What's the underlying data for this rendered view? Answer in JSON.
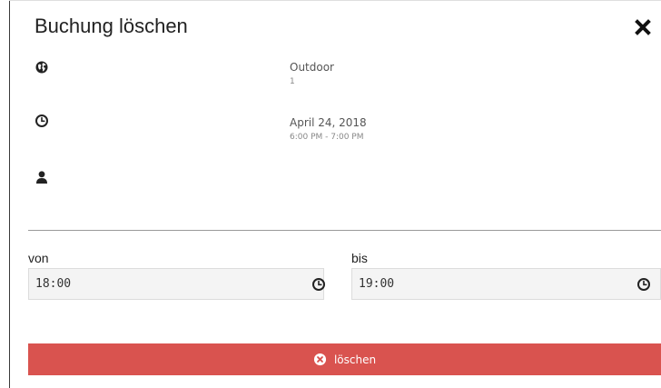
{
  "dialog": {
    "title": "Buchung löschen",
    "close_icon": "close-icon"
  },
  "details": {
    "location": {
      "icon": "globe-icon",
      "name": "Outdoor",
      "number": "1"
    },
    "time": {
      "icon": "clock-icon",
      "date": "April 24, 2018",
      "range": "6:00 PM - 7:00 PM"
    },
    "person": {
      "icon": "user-icon"
    }
  },
  "form": {
    "from": {
      "label": "von",
      "value": "18:00",
      "icon": "clock-icon"
    },
    "to": {
      "label": "bis",
      "value": "19:00",
      "icon": "clock-icon"
    }
  },
  "delete_button": {
    "label": "löschen",
    "icon": "times-circle-icon",
    "color": "#d9534f"
  }
}
